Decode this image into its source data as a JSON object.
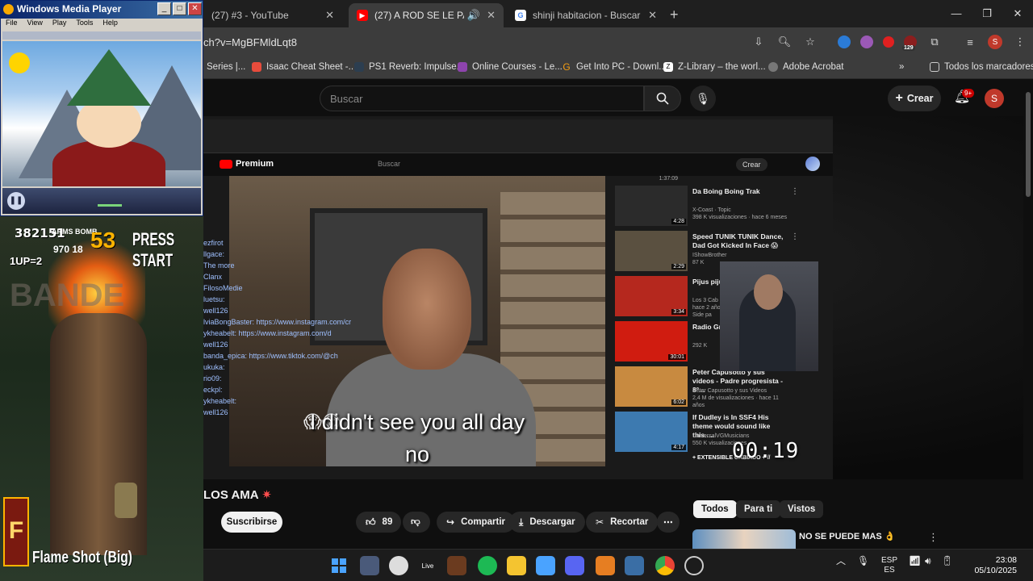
{
  "browser": {
    "tabs": [
      {
        "title": "(27) #3 - YouTube",
        "active": false
      },
      {
        "title": "(27) A ROD SE LE PARA Y LC",
        "active": true
      },
      {
        "title": "shinji habitacion - Buscar con G",
        "active": false
      }
    ],
    "url": "ch?v=MgBFMldLqt8",
    "bookmarks": [
      "Series |...",
      "Isaac Cheat Sheet -...",
      "PS1 Reverb: Impulse...",
      "Online Courses - Le...",
      "Get Into PC - Downl...",
      "Z-Library – the worl...",
      "Adobe Acrobat"
    ],
    "all_bookmarks": "Todos los marcadores",
    "extension_badge": "129",
    "profile_letter": "S"
  },
  "youtube": {
    "search_placeholder": "Buscar",
    "create_label": "Crear",
    "notif_count": "9+",
    "avatar_letter": "S",
    "video_title": "LOS AMA",
    "subscribe_label": "Suscribirse",
    "likes": "89",
    "share_label": "Compartir",
    "download_label": "Descargar",
    "clip_label": "Recortar",
    "chips": [
      "Todos",
      "Para ti",
      "Vistos"
    ],
    "side_video_title": "NO SE PUEDE MAS 👌",
    "colors": {
      "accent": "#ff0000",
      "bg": "#0f0f0f"
    }
  },
  "video": {
    "inner_logo": "Premium",
    "inner_search": "Buscar",
    "inner_create": "Crear",
    "subtitle_line1": "I didn't see you all day",
    "subtitle_line2": "no",
    "subtitle_emoji": "😱😱",
    "timer": "00:19",
    "chat_lines": [
      "ezfirot",
      "llgace:",
      "The more",
      "Clanx",
      "FilosoMedie",
      "luetsu:",
      "well126",
      "lviaBongBaster: https://www.instagram.com/cr",
      "ykheabelt: https://www.instagram.com/d",
      "well126",
      "banda_epica: https://www.tiktok.com/@ch",
      "ukuka:",
      "rio09:",
      "eckpl:",
      "ykheabelt:",
      "well126"
    ],
    "related": [
      {
        "title": "Da Boing Boing Trak",
        "meta": "X-Coast · Topic\n398 K visualizaciones · hace 6 meses",
        "duration": "4:28",
        "thumb": "#2b2b2b"
      },
      {
        "title": "Speed TUNIK TUNIK Dance, Dad Got Kicked In Face 😱",
        "meta": "IShowBrother\n87 K",
        "duration": "2:29",
        "thumb": "#5a5040"
      },
      {
        "title": "Pijus pijus",
        "meta": "Los 3 Cab\nhace 2 años\nSide pa",
        "duration": "3:34",
        "thumb": "#b5281e"
      },
      {
        "title": "Radio Grad",
        "meta": "292 K",
        "duration": "30:01",
        "thumb": "#d01c10"
      },
      {
        "title": "Peter Capusotto y sus videos - Padre progresista - 8°...",
        "meta": "Peter Capusotto y sus Videos\n2,4 M de visualizaciones · hace 11 años",
        "duration": "6:02",
        "thumb": "#c88a40"
      },
      {
        "title": "If Dudley is In SSF4 His theme would sound like this.....",
        "meta": "UniversalVGMusicians\n550 K visualizaciones",
        "duration": "4:17",
        "thumb": "#3d7ab0"
      }
    ],
    "extra_rel": "+ EXTENSIBLE CABIADO + //",
    "first_dur": "1:37:09"
  },
  "wmp": {
    "title": "Windows Media Player",
    "menu": [
      "File",
      "View",
      "Play",
      "Tools",
      "Help"
    ]
  },
  "game": {
    "score": "382151",
    "arms_label": "ARMS BOMB",
    "arms_value": "970 18",
    "timer": "53",
    "press_start": "PRESS START",
    "lives": "1UP=2",
    "bander": "BANDE",
    "weapon_letter": "F",
    "weapon_name": "Flame Shot (Big)"
  },
  "taskbar": {
    "lang1": "ESP",
    "lang2": "ES",
    "time": "23:08",
    "date": "05/10/2025"
  }
}
